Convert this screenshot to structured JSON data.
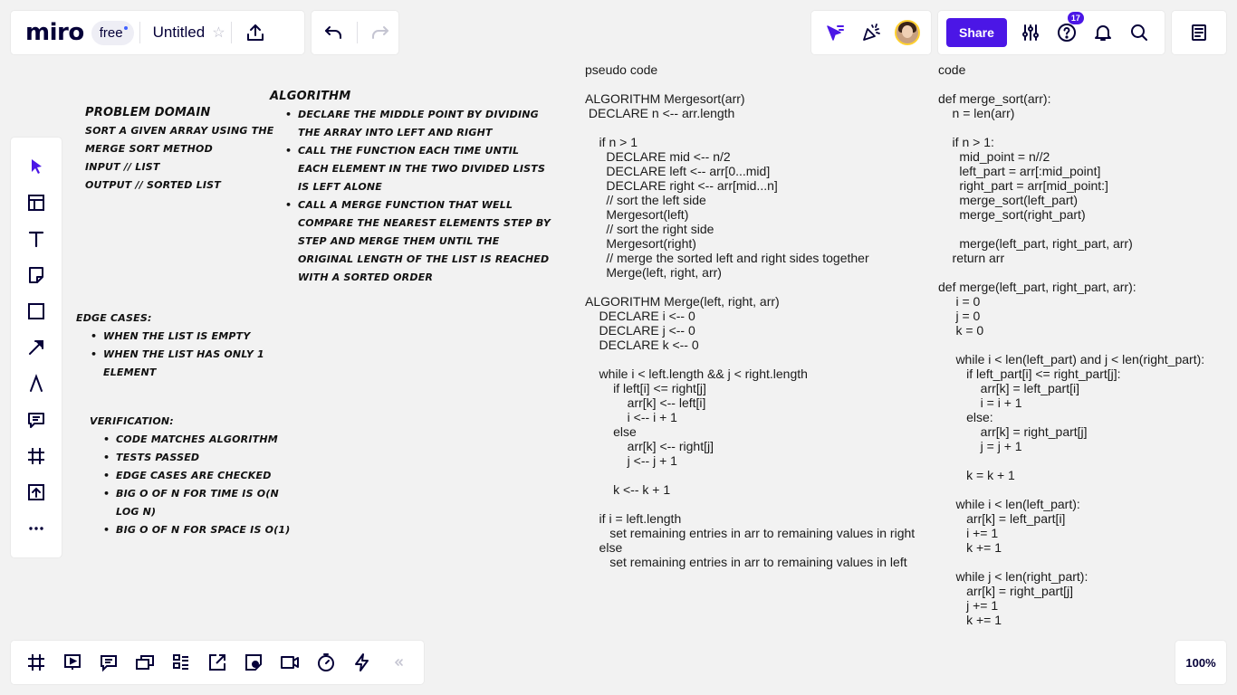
{
  "topbar": {
    "logo": "miro",
    "plan": "free",
    "board_title": "Untitled"
  },
  "share": {
    "label": "Share"
  },
  "help": {
    "badge_count": "17"
  },
  "zoom": {
    "level": "100%"
  },
  "colors": {
    "accent": "#4b16e6",
    "canvas": "#f2f2f2"
  },
  "left_toolbar_icons": [
    "select-icon",
    "templates-icon",
    "text-icon",
    "sticky-note-icon",
    "shape-icon",
    "connector-icon",
    "pen-icon",
    "comment-icon",
    "frame-icon",
    "upload-icon",
    "more-icon"
  ],
  "bottom_toolbar_icons": [
    "frames-icon",
    "presentation-icon",
    "comments-list-icon",
    "cards-icon",
    "kanban-icon",
    "export-icon",
    "sticky-note-add-icon",
    "video-icon",
    "timer-icon",
    "lightning-icon",
    "collapse-icon"
  ],
  "board": {
    "problem_domain": {
      "title": "Problem Domain",
      "lines": [
        "Sort a given array using the",
        "merge sort method",
        "Input // list",
        "Output // sorted list"
      ]
    },
    "algorithm": {
      "title": "Algorithm",
      "items": [
        "Declare the middle point by dividing the array into left and right",
        "Call the function each time until each element in the two divided lists is left alone",
        "Call a merge function that well compare the nearest elements step by step and merge them until the original length of the list is reached with a sorted order"
      ]
    },
    "edge_cases": {
      "title": "Edge cases:",
      "items": [
        "When the list is empty",
        "When the list has only 1 element"
      ]
    },
    "verification": {
      "title": "Verification:",
      "items": [
        "Code matches algorithm",
        "Tests passed",
        "edge cases are checked",
        "Big O of n for time is O(n log n)",
        "Big O of n for space is O(1)"
      ]
    },
    "pseudo_code": "pseudo code\n\nALGORITHM Mergesort(arr)\n DECLARE n <-- arr.length\n\n    if n > 1\n      DECLARE mid <-- n/2\n      DECLARE left <-- arr[0...mid]\n      DECLARE right <-- arr[mid...n]\n      // sort the left side\n      Mergesort(left)\n      // sort the right side\n      Mergesort(right)\n      // merge the sorted left and right sides together\n      Merge(left, right, arr)\n\nALGORITHM Merge(left, right, arr)\n    DECLARE i <-- 0\n    DECLARE j <-- 0\n    DECLARE k <-- 0\n\n    while i < left.length && j < right.length\n        if left[i] <= right[j]\n            arr[k] <-- left[i]\n            i <-- i + 1\n        else\n            arr[k] <-- right[j]\n            j <-- j + 1\n\n        k <-- k + 1\n\n    if i = left.length\n       set remaining entries in arr to remaining values in right\n    else\n       set remaining entries in arr to remaining values in left",
    "code": "code\n\ndef merge_sort(arr):\n    n = len(arr)\n\n    if n > 1:\n      mid_point = n//2\n      left_part = arr[:mid_point]\n      right_part = arr[mid_point:]\n      merge_sort(left_part)\n      merge_sort(right_part)\n\n      merge(left_part, right_part, arr)\n    return arr\n\ndef merge(left_part, right_part, arr):\n     i = 0\n     j = 0\n     k = 0\n\n     while i < len(left_part) and j < len(right_part):\n        if left_part[i] <= right_part[j]:\n            arr[k] = left_part[i]\n            i = i + 1\n        else:\n            arr[k] = right_part[j]\n            j = j + 1\n\n        k = k + 1\n\n     while i < len(left_part):\n        arr[k] = left_part[i]\n        i += 1\n        k += 1\n\n     while j < len(right_part):\n        arr[k] = right_part[j]\n        j += 1\n        k += 1"
  }
}
